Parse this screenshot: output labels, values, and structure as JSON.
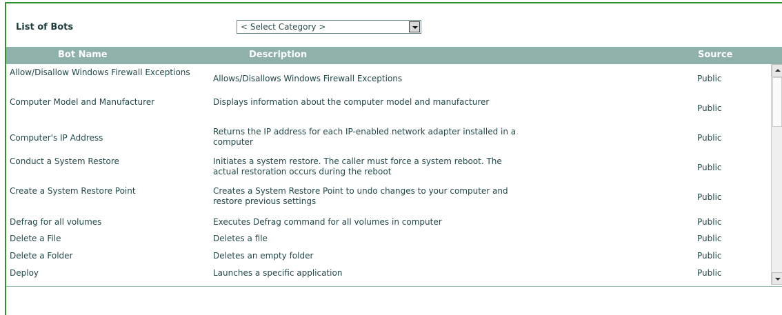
{
  "header": {
    "title": "List of Bots",
    "category_select": {
      "value": "< Select Category >"
    }
  },
  "table": {
    "columns": [
      "Bot Name",
      "Description",
      "Source"
    ],
    "rows": [
      {
        "name": "Allow/Disallow Windows Firewall Exceptions",
        "description": "Allows/Disallows Windows Firewall Exceptions",
        "source": "Public"
      },
      {
        "name": "Computer Model and Manufacturer",
        "description": "Displays information about the computer model and manufacturer",
        "source": "Public"
      },
      {
        "name": "Computer's IP Address",
        "description": "Returns the IP address for each IP-enabled network adapter installed in a computer",
        "source": "Public"
      },
      {
        "name": "Conduct a System Restore",
        "description": "Initiates a system restore. The caller must force a system reboot. The actual restoration occurs during the reboot",
        "source": "Public"
      },
      {
        "name": "Create a System Restore Point",
        "description": "Creates a System Restore Point to undo changes to your computer and restore previous settings",
        "source": "Public"
      },
      {
        "name": "Defrag for all volumes",
        "description": "Executes Defrag command for all volumes in computer",
        "source": "Public"
      },
      {
        "name": "Delete a File",
        "description": "Deletes a file",
        "source": "Public"
      },
      {
        "name": "Delete a Folder",
        "description": "Deletes an empty folder",
        "source": "Public"
      },
      {
        "name": "Deploy",
        "description": "Launches a specific application",
        "source": "Public"
      }
    ]
  },
  "colors": {
    "frame_border": "#2f8f2f",
    "header_bg": "#8eb1a9",
    "text": "#234848"
  }
}
